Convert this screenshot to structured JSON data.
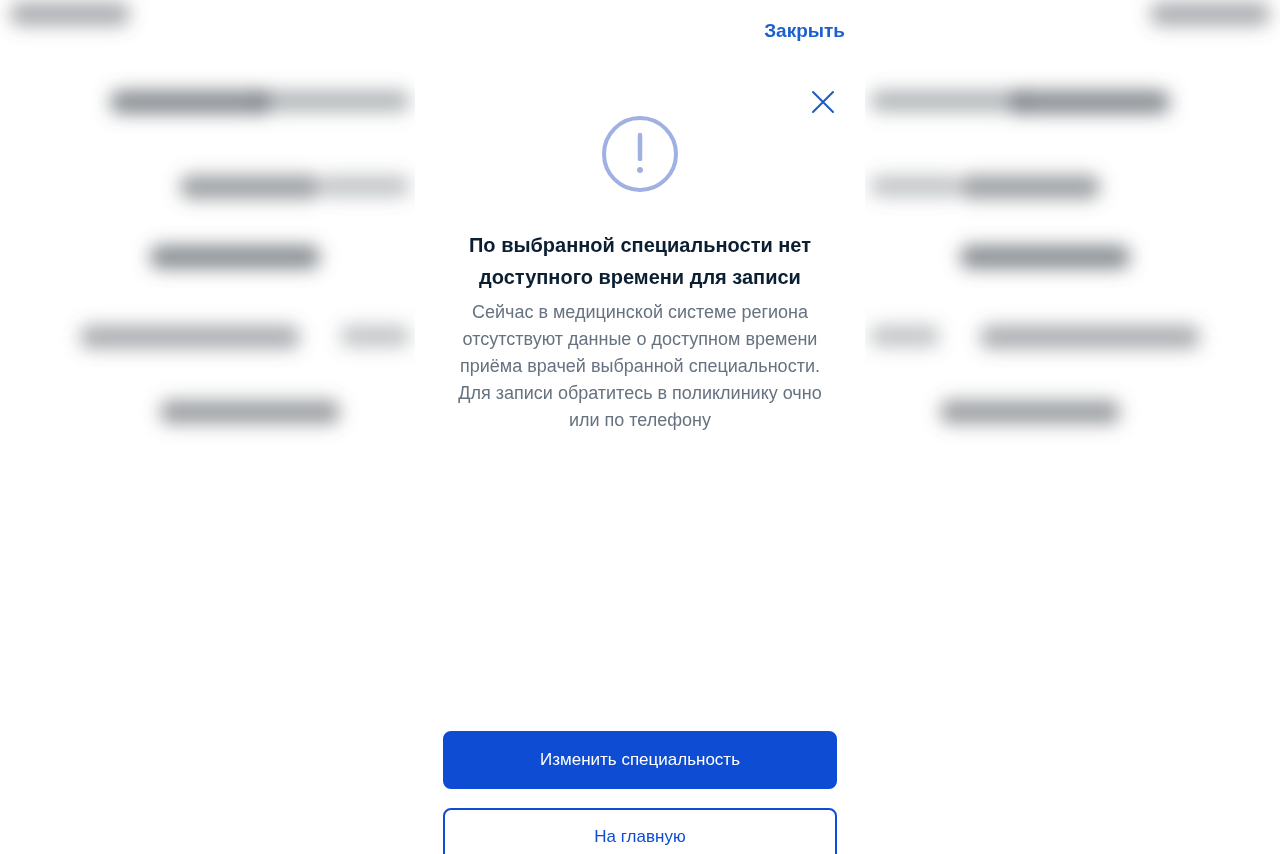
{
  "header": {
    "close_link": "Закрыть"
  },
  "dialog": {
    "title": "По выбранной специальности нет доступного времени для записи",
    "message": "Сейчас в медицинской системе региона отсутствуют данные о доступном времени приёма врачей выбранной специальности. Для записи обратитесь в поликлинику очно или по телефону"
  },
  "buttons": [
    {
      "label": "Изменить специальность",
      "kind": "primary"
    },
    {
      "label": "На главную",
      "kind": "secondary"
    }
  ]
}
